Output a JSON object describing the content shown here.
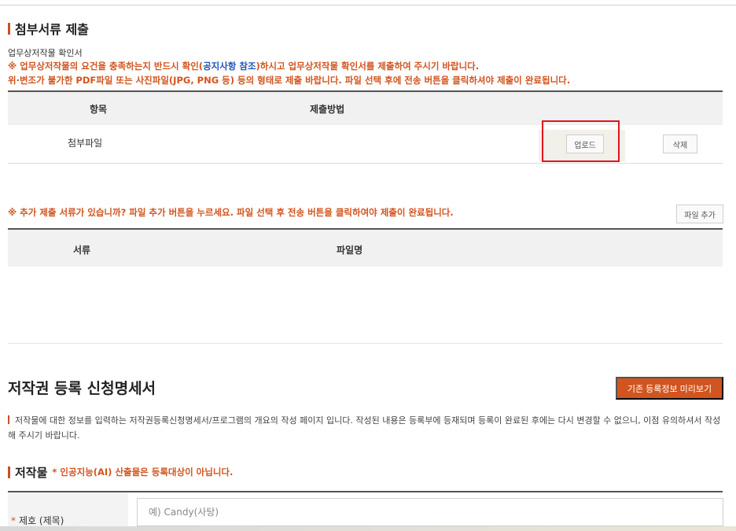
{
  "attach": {
    "title": "첨부서류 제출",
    "doc_name": "업무상저작물 확인서",
    "notice1_a": "※ 업무상저작물의 요건을 충족하는지 반드시 확인(",
    "notice1_link": "공지사항 참조",
    "notice1_b": ")하시고 업무상저작물 확인서를 제출하여 주시기 바랍니다.",
    "notice2": "위·변조가 불가한 PDF파일 또는 사진파일(JPG, PNG 등) 등의 형태로 제출 바랍니다.  파일 선택 후에 전송 버튼을 클릭하셔야 제출이 완료됩니다.",
    "col_item": "항목",
    "col_method": "제출방법",
    "row_label": "첨부파일",
    "upload_label": "업로드",
    "delete_label": "삭제"
  },
  "additional": {
    "notice": "※ 추가 제출 서류가 있습니까? 파일 추가 버튼을 누르세요. 파일 선택 후 전송 버튼을 클릭하여야 제출이 완료됩니다.",
    "add_file_label": "파일 추가",
    "col_doc": "서류",
    "col_filename": "파일명"
  },
  "application": {
    "title": "저작권 등록 신청명세서",
    "preview_button": "기존 등록정보 미리보기",
    "description": "저작물에 대한 정보를 입력하는 저작권등록신청명세서/프로그램의 개요의 작성 페이지 입니다. 작성된 내용은 등록부에 등재되며 등록이 완료된 후에는 다시 변경할 수 없으니, 이점 유의하셔서 작성해 주시기 바랍니다."
  },
  "work": {
    "title": "저작물",
    "required_note": "* 인공지능(AI) 산출물은 등록대상이 아닙니다.",
    "field_star": "*",
    "field_label": "제호 (제목)",
    "title_placeholder": "예) Candy(사탕)"
  },
  "colors": {
    "accent": "#d2541e",
    "link_blue": "#1f55b8",
    "highlight_red": "#e0141e"
  }
}
